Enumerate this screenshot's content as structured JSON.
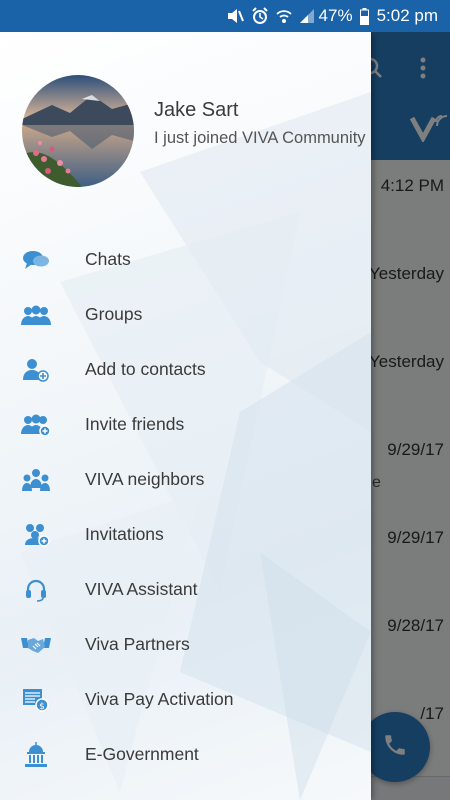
{
  "status_bar": {
    "battery": "47%",
    "time": "5:02 pm"
  },
  "background": {
    "rows": [
      {
        "time": "4:12 PM",
        "sub": ""
      },
      {
        "time": "Yesterday",
        "sub": ""
      },
      {
        "time": "Yesterday",
        "sub": ""
      },
      {
        "time": "9/29/17",
        "sub": "e"
      },
      {
        "time": "9/29/17",
        "sub": ""
      },
      {
        "time": "9/28/17",
        "sub": ""
      },
      {
        "time": "/17",
        "sub": ""
      }
    ]
  },
  "profile": {
    "name": "Jake Sart",
    "status": "I just joined VIVA Community"
  },
  "menu": [
    {
      "label": "Chats",
      "icon": "chat-bubbles-icon"
    },
    {
      "label": "Groups",
      "icon": "group-icon"
    },
    {
      "label": "Add to contacts",
      "icon": "add-contact-icon"
    },
    {
      "label": "Invite friends",
      "icon": "invite-friends-icon"
    },
    {
      "label": "VIVA neighbors",
      "icon": "neighbors-icon"
    },
    {
      "label": "Invitations",
      "icon": "invitations-icon"
    },
    {
      "label": "VIVA Assistant",
      "icon": "headset-icon"
    },
    {
      "label": "Viva Partners",
      "icon": "handshake-icon"
    },
    {
      "label": "Viva Pay Activation",
      "icon": "payment-icon"
    },
    {
      "label": "E-Government",
      "icon": "government-building-icon"
    }
  ],
  "colors": {
    "primary": "#2b7dc2",
    "status_bar": "#1a63a8",
    "icon_blue": "#3c8fd0"
  }
}
